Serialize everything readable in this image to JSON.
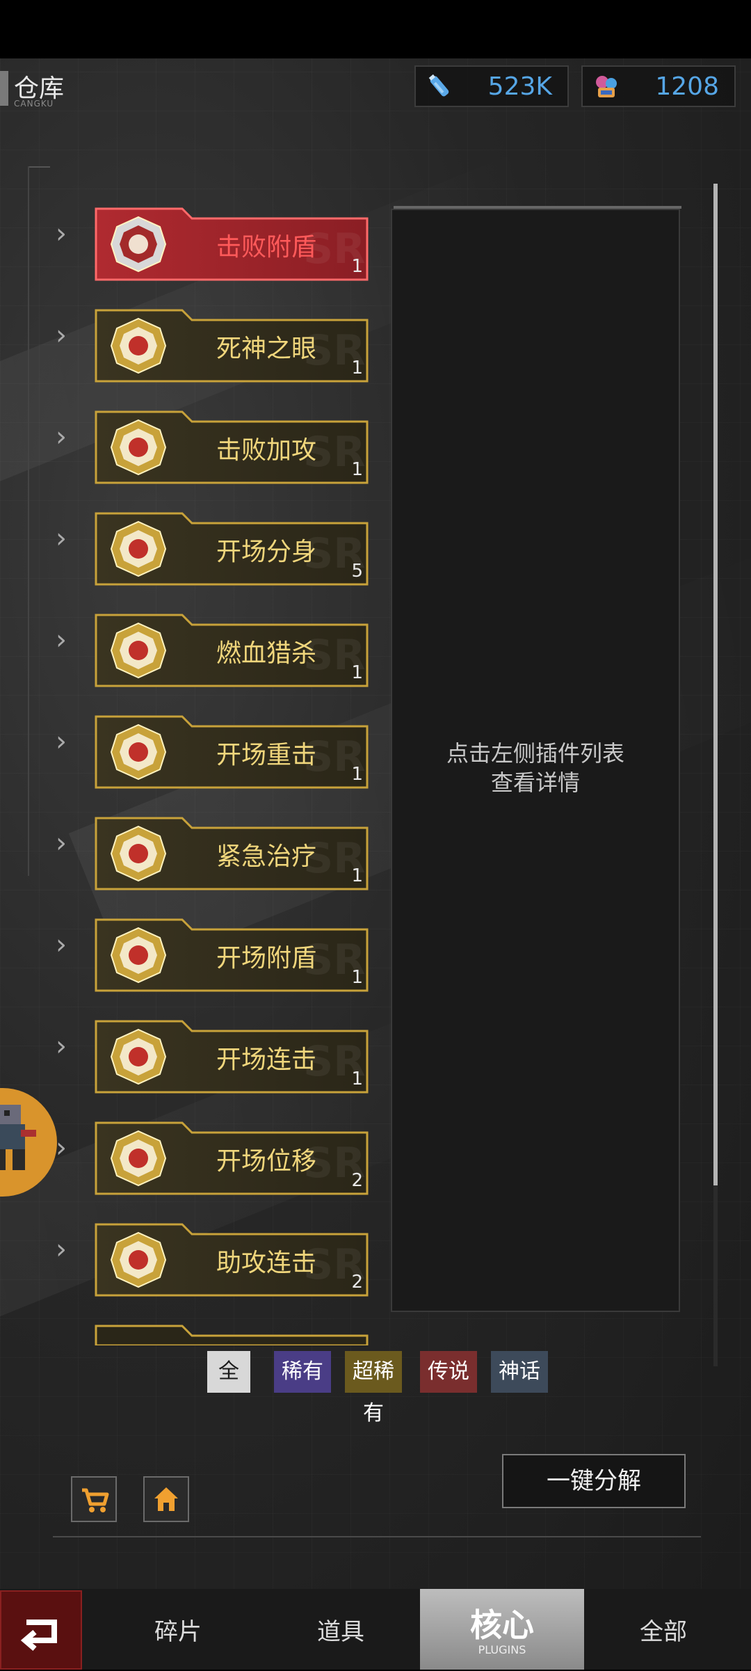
{
  "header": {
    "title": "仓库",
    "subtitle": "CANGKU",
    "currency": [
      {
        "icon": "energy-bottle-icon",
        "value": "523K"
      },
      {
        "icon": "gems-icon",
        "value": "1208"
      }
    ]
  },
  "plugins": [
    {
      "name": "击败附盾",
      "count": "1",
      "rarity": "legend",
      "icon": "shield-icon"
    },
    {
      "name": "死神之眼",
      "count": "1",
      "rarity": "gold",
      "icon": "sword-icon"
    },
    {
      "name": "击败加攻",
      "count": "1",
      "rarity": "gold",
      "icon": "blade-icon"
    },
    {
      "name": "开场分身",
      "count": "5",
      "rarity": "gold",
      "icon": "clone-icon"
    },
    {
      "name": "燃血猎杀",
      "count": "1",
      "rarity": "gold",
      "icon": "blood-icon"
    },
    {
      "name": "开场重击",
      "count": "1",
      "rarity": "gold",
      "icon": "heavy-hit-icon"
    },
    {
      "name": "紧急治疗",
      "count": "1",
      "rarity": "gold",
      "icon": "heal-icon"
    },
    {
      "name": "开场附盾",
      "count": "1",
      "rarity": "gold",
      "icon": "shield-icon"
    },
    {
      "name": "开场连击",
      "count": "1",
      "rarity": "gold",
      "icon": "combo-icon"
    },
    {
      "name": "开场位移",
      "count": "2",
      "rarity": "gold",
      "icon": "dash-icon"
    },
    {
      "name": "助攻连击",
      "count": "2",
      "rarity": "gold",
      "icon": "assist-icon"
    }
  ],
  "detail": {
    "hint_line1": "点击左侧插件列表",
    "hint_line2": "查看详情"
  },
  "filters": [
    {
      "label": "全",
      "color": "#d8d8d8",
      "text": "#1a1a1a"
    },
    {
      "label": "稀有",
      "color": "#4a3d86",
      "text": "#ffffff"
    },
    {
      "label": "超稀有",
      "color": "#6b5a1e",
      "text": "#ffffff"
    },
    {
      "label": "传说",
      "color": "#7a2e2e",
      "text": "#ffffff"
    },
    {
      "label": "神话",
      "color": "#3d4a5a",
      "text": "#ffffff"
    }
  ],
  "actions": {
    "decompose_label": "一键分解",
    "shop_icon": "cart-icon",
    "home_icon": "home-icon"
  },
  "tabs": {
    "fragments": "碎片",
    "items": "道具",
    "core": "核心",
    "core_sub": "PLUGINS",
    "all": "全部"
  },
  "colors": {
    "gold_text": "#f0d67c",
    "legend_text": "#ff5a5a",
    "currency_text": "#56a6e6"
  }
}
